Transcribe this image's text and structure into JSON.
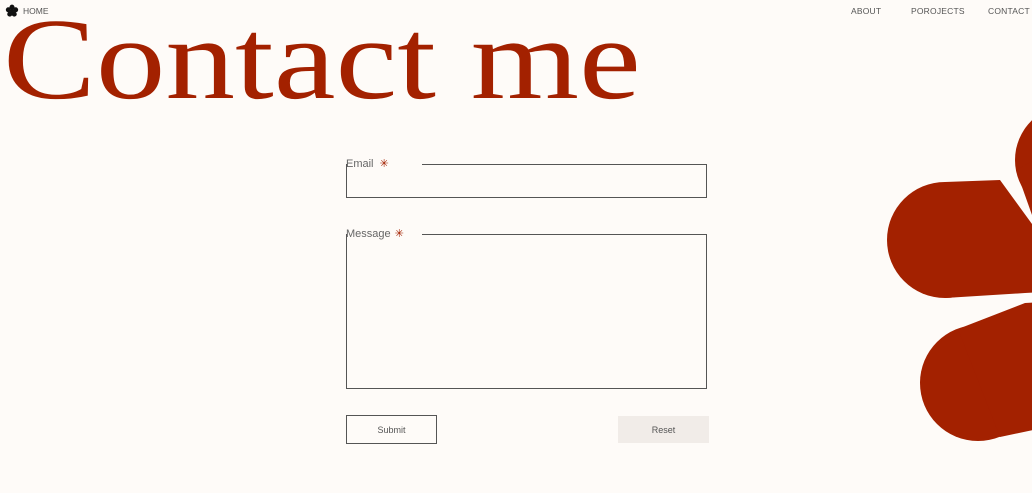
{
  "nav": {
    "home": "HOME",
    "links": [
      "ABOUT",
      "POROJECTS",
      "CONTACT"
    ]
  },
  "page_title": "Contact me",
  "form": {
    "email_label": "Email",
    "message_label": "Message",
    "required_mark": "✳",
    "email_value": "",
    "message_value": "",
    "submit_label": "Submit",
    "reset_label": "Reset"
  },
  "colors": {
    "accent": "#a32100",
    "background": "#fefbf8"
  }
}
